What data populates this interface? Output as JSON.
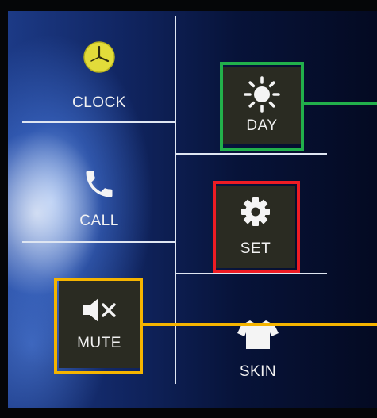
{
  "menu": {
    "clock": {
      "label": "CLOCK",
      "icon": "clock-icon"
    },
    "call": {
      "label": "CALL",
      "icon": "phone-icon"
    },
    "mute": {
      "label": "MUTE",
      "icon": "speaker-mute-icon"
    },
    "day": {
      "label": "DAY",
      "icon": "sun-icon"
    },
    "set": {
      "label": "SET",
      "icon": "gear-icon"
    },
    "skin": {
      "label": "SKIN",
      "icon": "shirt-icon"
    }
  },
  "annotations": [
    {
      "target": "day",
      "color": "#22b04b"
    },
    {
      "target": "set",
      "color": "#ee1c24"
    },
    {
      "target": "mute",
      "color": "#f5b400"
    }
  ],
  "colors": {
    "background": "#0b1a4a",
    "divider": "#dfe6f2",
    "clock_face": "#e2dc3a"
  }
}
